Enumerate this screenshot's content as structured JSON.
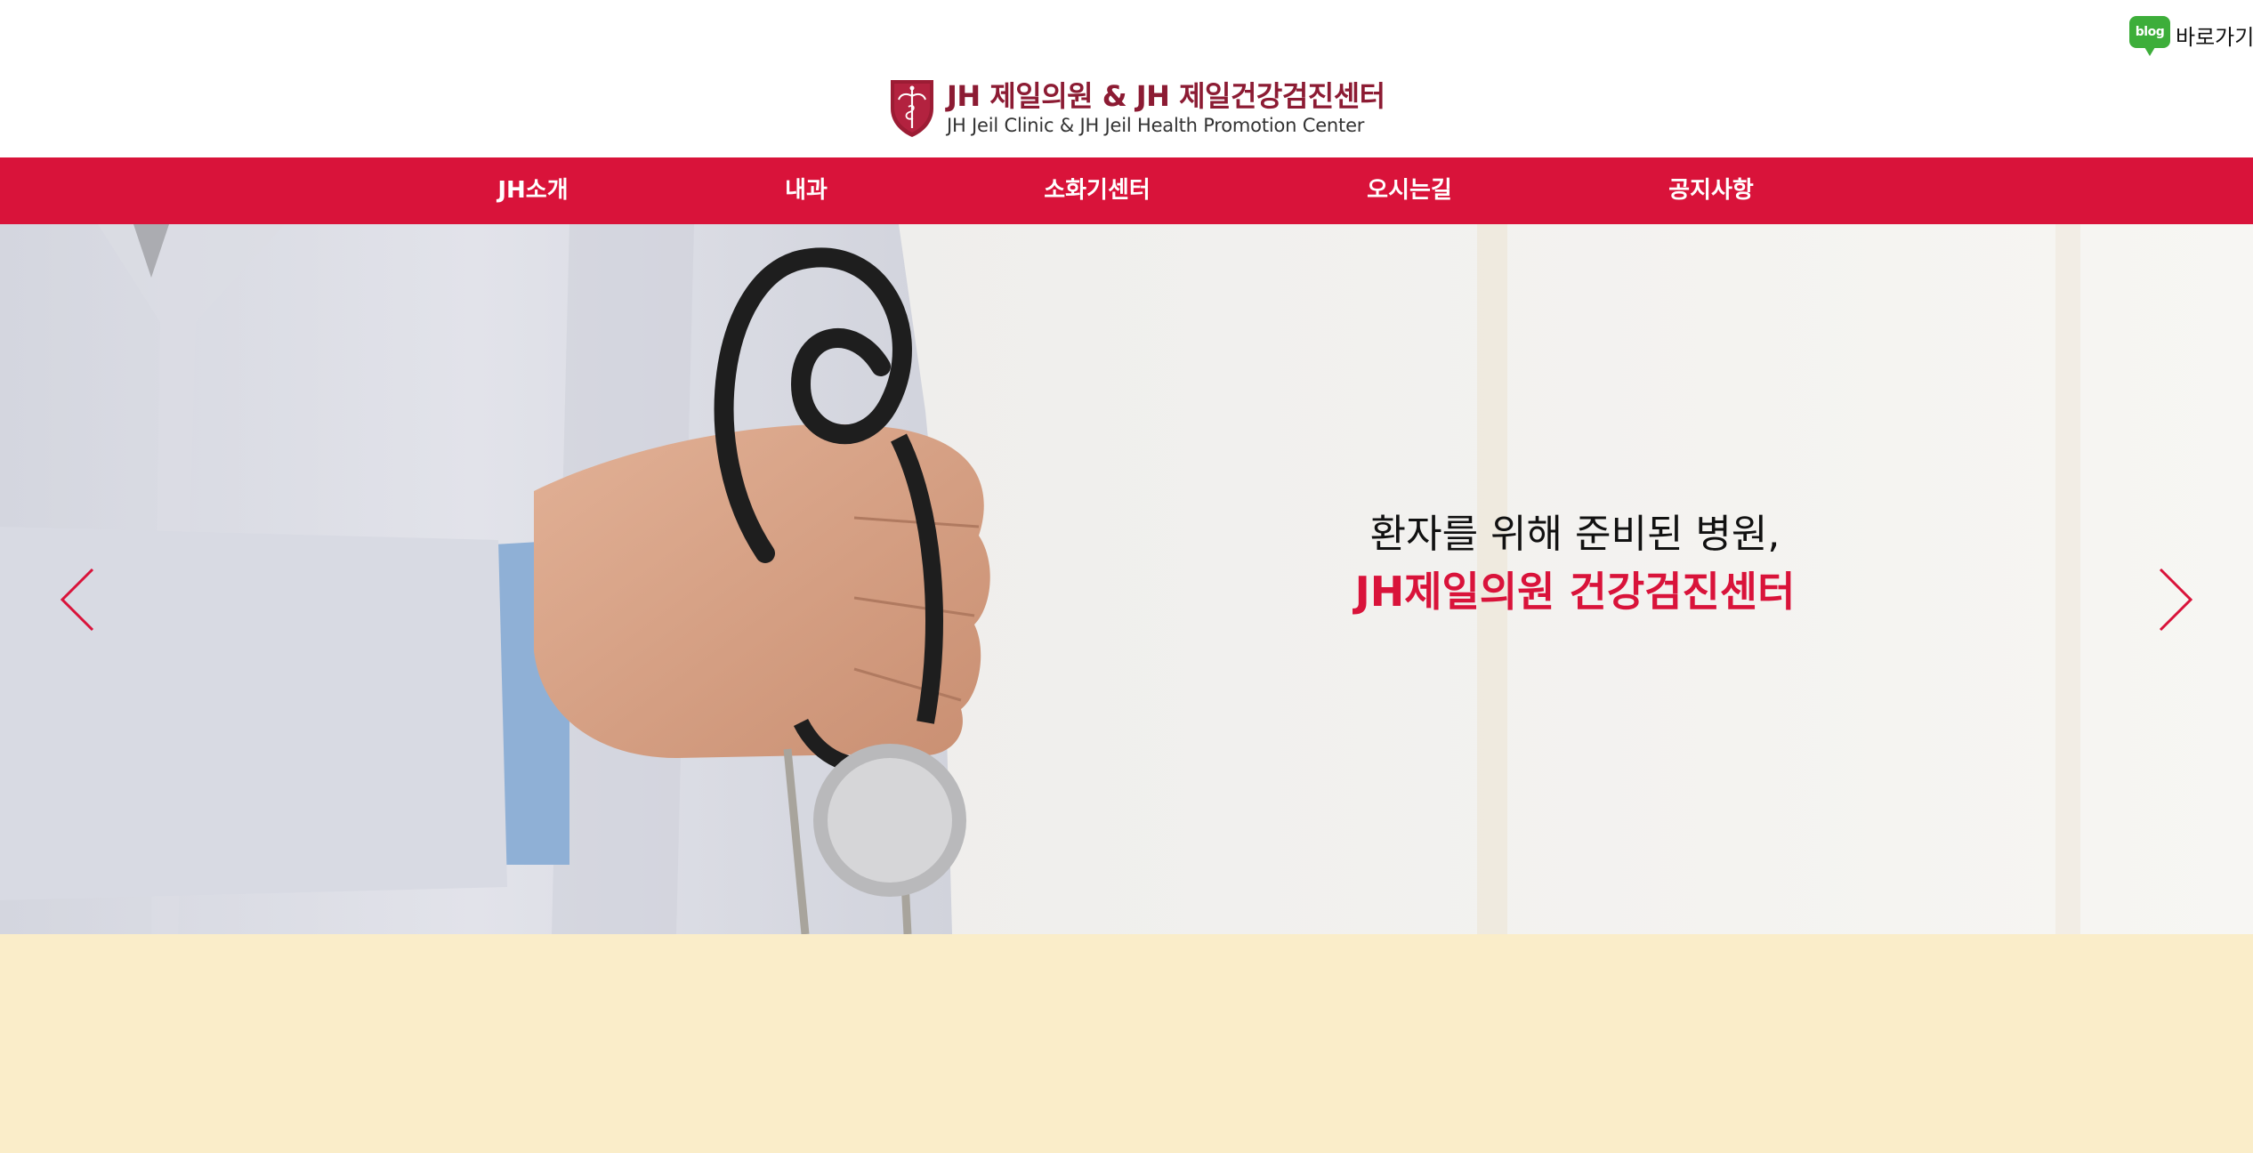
{
  "header": {
    "blog": {
      "icon_text": "blog",
      "label": "바로가기"
    },
    "logo": {
      "title": "JH 제일의원 & JH 제일건강검진센터",
      "subtitle": "JH Jeil Clinic & JH Jeil Health Promotion Center"
    }
  },
  "nav": {
    "items": [
      {
        "label": "JH소개"
      },
      {
        "label": "내과"
      },
      {
        "label": "소화기센터"
      },
      {
        "label": "오시는길"
      },
      {
        "label": "공지사항"
      }
    ]
  },
  "hero": {
    "line1": "환자를 위해 준비된 병원,",
    "line2": "JH제일의원 건강검진센터",
    "prev_icon": "chevron-left-icon",
    "next_icon": "chevron-right-icon"
  },
  "colors": {
    "brand_red": "#d9133a",
    "logo_maroon": "#8c1b33",
    "blog_green": "#3dae3a",
    "lower_band": "#faedc9"
  }
}
